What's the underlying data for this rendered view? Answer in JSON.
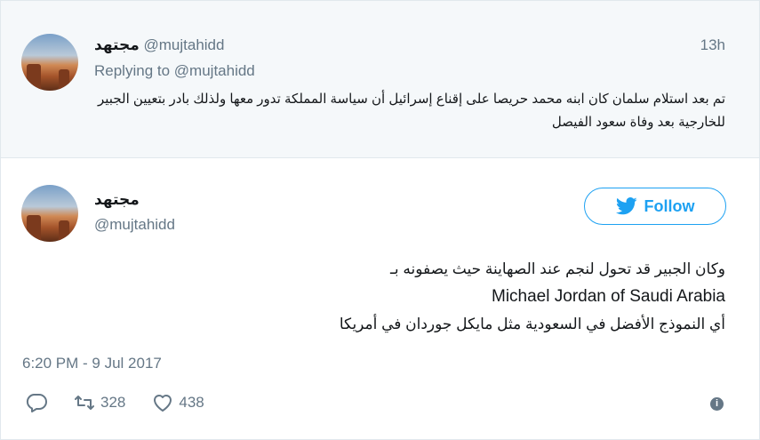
{
  "parent_tweet": {
    "display_name": "مجتهد",
    "handle": "@mujtahidd",
    "time": "13h",
    "replying_prefix": "Replying to",
    "replying_handle": "@mujtahidd",
    "text": "تم بعد استلام سلمان كان ابنه محمد حريصا على إقناع إسرائيل أن سياسة المملكة تدور معها ولذلك بادر بتعيين الجبير للخارجية بعد وفاة سعود الفيصل"
  },
  "main_tweet": {
    "display_name": "مجتهد",
    "handle": "@mujtahidd",
    "follow_label": "Follow",
    "text_line1": "وكان الجبير قد تحول لنجم عند الصهاينة حيث يصفونه بـ",
    "text_line2": "Michael Jordan of Saudi Arabia",
    "text_line3": "أي النموذج الأفضل في السعودية مثل مايكل جوردان في أمريكا",
    "timestamp": "6:20 PM - 9 Jul 2017",
    "retweet_count": "328",
    "like_count": "438"
  },
  "colors": {
    "accent": "#1da1f2",
    "muted": "#657786",
    "parent_bg": "#f5f8fa"
  },
  "icons": [
    "reply-icon",
    "retweet-icon",
    "like-icon",
    "info-icon",
    "twitter-bird-icon"
  ]
}
